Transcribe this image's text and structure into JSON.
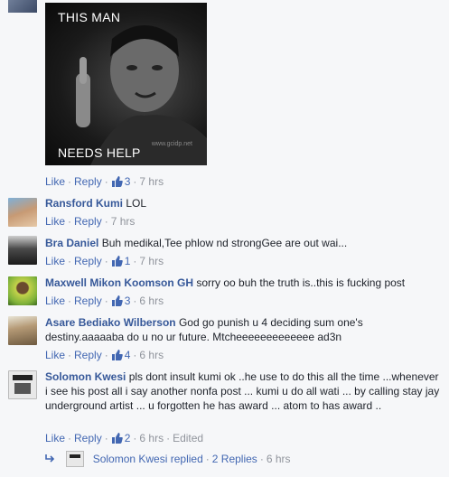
{
  "image_post": {
    "caption_top": "THIS MAN",
    "caption_bottom": "NEEDS HELP",
    "watermark": "www.gcidp.net",
    "like": "Like",
    "reply": "Reply",
    "reactions": "3",
    "time": "7 hrs"
  },
  "comments": [
    {
      "name": "Ransford Kumi",
      "text": "LOL",
      "like": "Like",
      "reply": "Reply",
      "reactions": "",
      "time": "7 hrs"
    },
    {
      "name": "Bra Daniel",
      "text": "Buh medikal,Tee phlow nd strongGee are out wai...",
      "like": "Like",
      "reply": "Reply",
      "reactions": "1",
      "time": "7 hrs"
    },
    {
      "name": "Maxwell Mikon Koomson GH",
      "text": "sorry oo buh the truth is..this is fucking post",
      "like": "Like",
      "reply": "Reply",
      "reactions": "3",
      "time": "6 hrs"
    },
    {
      "name": "Asare Bediako Wilberson",
      "text": "God go punish u 4 deciding sum one's destiny.aaaaaba do u no ur future. Mtcheeeeeeeeeeeee ad3n",
      "like": "Like",
      "reply": "Reply",
      "reactions": "4",
      "time": "6 hrs"
    },
    {
      "name": "Solomon Kwesi",
      "text": "pls dont insult kumi ok ..he use to do this all the time ...whenever i see his post all i say another nonfa post ... kumi u do all wati ... by calling stay jay underground artist ... u forgotten he has award ... atom to has award ..",
      "like": "Like",
      "reply": "Reply",
      "reactions": "2",
      "time": "6 hrs",
      "edited": "Edited"
    }
  ],
  "replies_summary": {
    "name": "Solomon Kwesi",
    "action": "replied",
    "count": "2 Replies",
    "time": "6 hrs"
  },
  "colors": {
    "link": "#4267b2",
    "name": "#365899",
    "meta": "#90949c",
    "bg": "#f6f7f9"
  }
}
